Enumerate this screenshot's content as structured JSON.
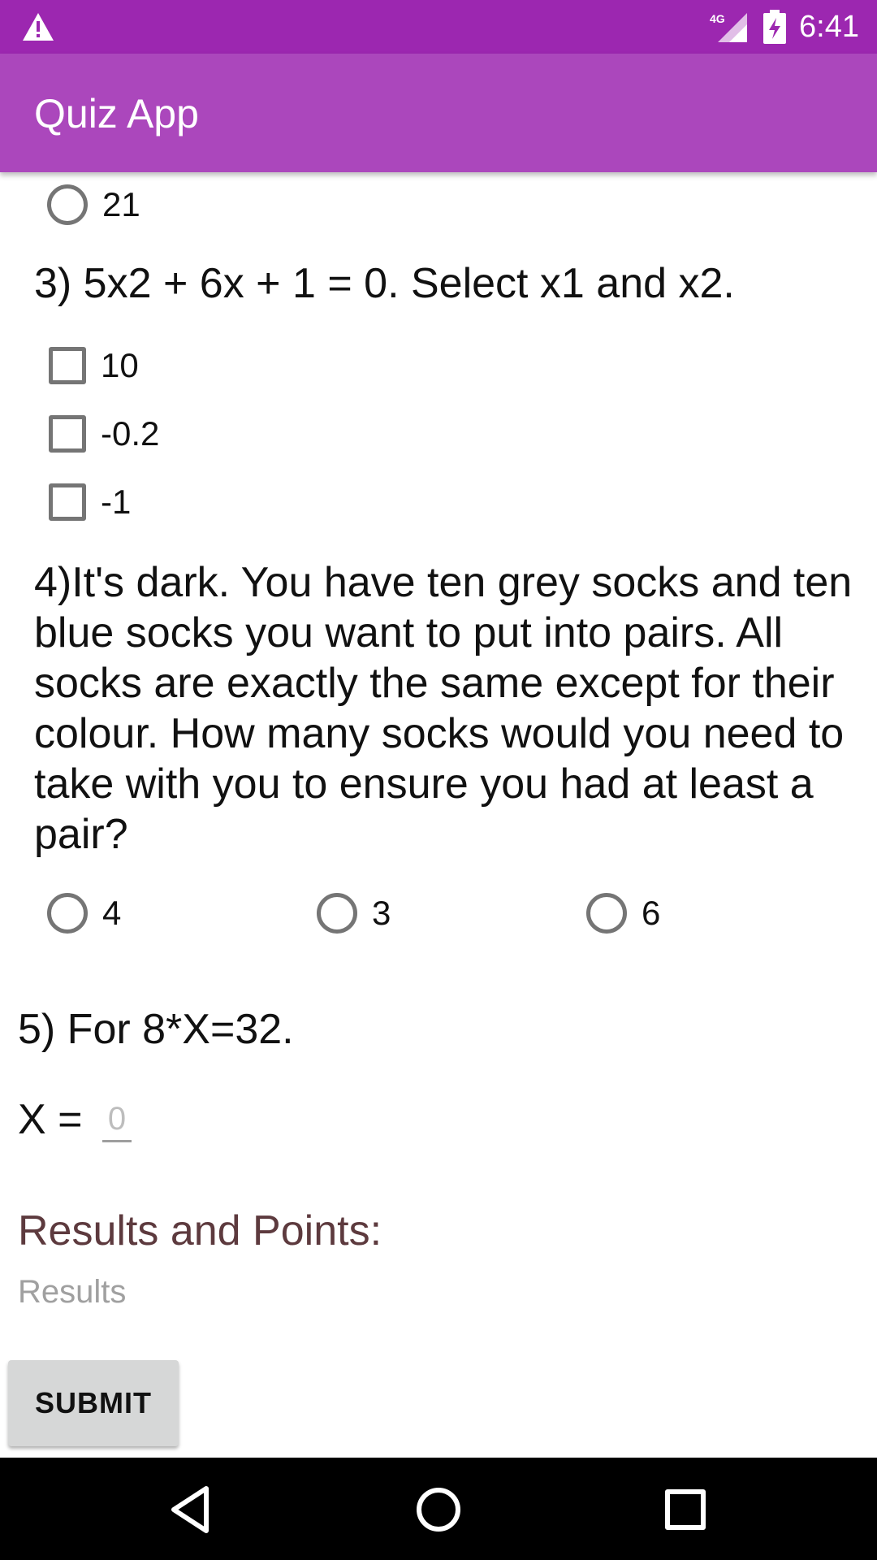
{
  "status_bar": {
    "time": "6:41",
    "network": "4G",
    "icons": [
      "warning-icon",
      "signal-icon",
      "battery-charging-icon"
    ]
  },
  "app_bar": {
    "title": "Quiz App"
  },
  "question2": {
    "partial_option": "21"
  },
  "question3": {
    "text": "3) 5x2 + 6x + 1 = 0. Select x1 and x2.",
    "options": [
      "10",
      "-0.2",
      "-1"
    ]
  },
  "question4": {
    "text": "4)It's dark. You have ten grey socks and ten blue socks you want to put into pairs. All socks are exactly the same except for their colour. How many socks would you need to take with you to ensure you had at least a pair?",
    "options": [
      "4",
      "3",
      "6"
    ]
  },
  "question5": {
    "text": "5) For 8*X=32.",
    "x_label": "X =",
    "placeholder": "0"
  },
  "results": {
    "title": "Results and Points:",
    "text": "Results"
  },
  "submit": {
    "label": "SUBMIT"
  },
  "nav": {
    "icons": [
      "back-icon",
      "home-icon",
      "recents-icon"
    ]
  },
  "colors": {
    "status_bar": "#9c27b0",
    "app_bar": "#ab47bc",
    "results_title": "#5d3a3e"
  }
}
